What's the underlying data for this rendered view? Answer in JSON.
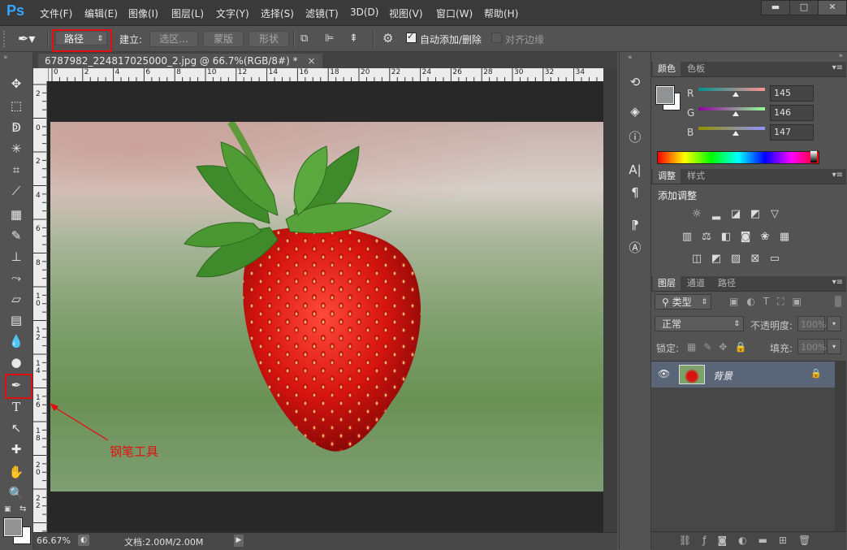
{
  "app": {
    "logo": "Ps"
  },
  "menu": [
    "文件(F)",
    "编辑(E)",
    "图像(I)",
    "图层(L)",
    "文字(Y)",
    "选择(S)",
    "滤镜(T)",
    "3D(D)",
    "视图(V)",
    "窗口(W)",
    "帮助(H)"
  ],
  "window_controls": {
    "minimize": "▬",
    "maximize": "□",
    "close": "✕"
  },
  "options": {
    "mode_select": "路径",
    "build_label": "建立:",
    "selection_btn": "选区...",
    "mask_btn": "蒙版",
    "shape_btn": "形状",
    "auto_add_delete": "自动添加/删除",
    "align_edges": "对齐边缘"
  },
  "document": {
    "tab_title": "6787982_224817025000_2.jpg @ 66.7%(RGB/8#) *",
    "tab_close": "×",
    "hruler_labels": [
      "0",
      "2",
      "4",
      "6",
      "8",
      "10",
      "12",
      "14",
      "16",
      "18",
      "20",
      "22",
      "24",
      "26",
      "28",
      "30",
      "32",
      "34"
    ],
    "vruler_labels": [
      "2",
      "0",
      "2",
      "4",
      "6",
      "8",
      "1 0",
      "1 2",
      "1 4",
      "1 6",
      "1 8",
      "2 0",
      "2 2"
    ]
  },
  "status": {
    "zoom": "66.67%",
    "doc_size": "文档:2.00M/2.00M"
  },
  "annotation": {
    "label": "钢笔工具"
  },
  "panels": {
    "color": {
      "tabs": [
        "颜色",
        "色板"
      ],
      "channels": [
        {
          "label": "R",
          "value": "145",
          "gradient": "linear-gradient(90deg,#00918f,#ff9193)"
        },
        {
          "label": "G",
          "value": "146",
          "gradient": "linear-gradient(90deg,#9100a0,#91ff93)"
        },
        {
          "label": "B",
          "value": "147",
          "gradient": "linear-gradient(90deg,#919200,#9192ff)"
        }
      ]
    },
    "adjustments": {
      "tabs": [
        "调整",
        "样式"
      ],
      "title": "添加调整"
    },
    "layers": {
      "tabs": [
        "图层",
        "通道",
        "路径"
      ],
      "filter_kind": "类型",
      "blend_mode": "正常",
      "opacity_label": "不透明度:",
      "opacity_value": "100%",
      "lock_label": "锁定:",
      "fill_label": "填充:",
      "fill_value": "100%",
      "layer_name": "背景"
    }
  },
  "colors": {
    "accent_blue": "#31a8ff",
    "annotation_red": "#e01010"
  }
}
